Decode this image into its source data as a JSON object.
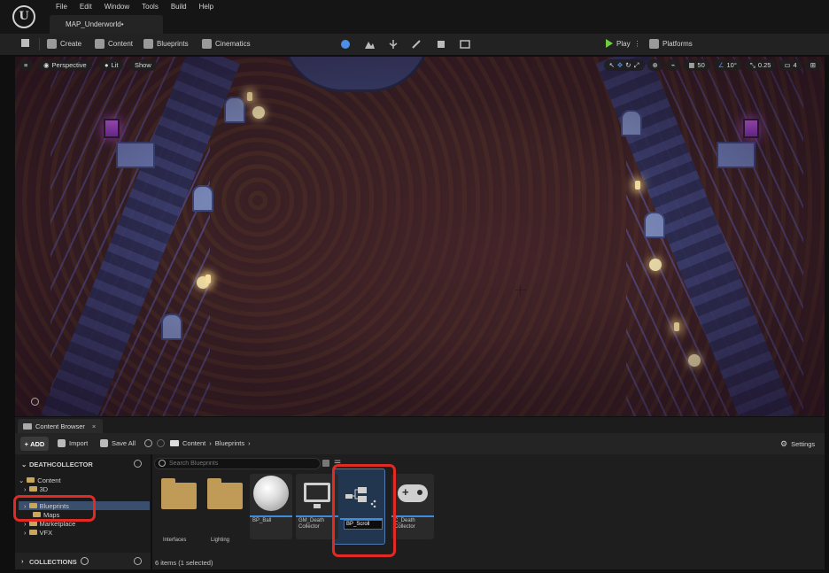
{
  "menu": [
    "File",
    "Edit",
    "Window",
    "Tools",
    "Build",
    "Help"
  ],
  "level_tab": "MAP_Underworld•",
  "toolbar": {
    "create": "Create",
    "content": "Content",
    "blueprints": "Blueprints",
    "cinematics": "Cinematics",
    "play": "Play",
    "platforms": "Platforms"
  },
  "viewport": {
    "perspective": "Perspective",
    "lit": "Lit",
    "show": "Show",
    "grid_size": "50",
    "rotation_snap": "10°",
    "scale_snap": "0.25",
    "camera_speed": "4"
  },
  "content_browser": {
    "tab_title": "Content Browser",
    "add_label": "ADD",
    "import_label": "Import",
    "save_all_label": "Save All",
    "breadcrumb": [
      "Content",
      "Blueprints"
    ],
    "settings_label": "Settings",
    "project_name": "DEATHCOLLECTOR",
    "tree": [
      {
        "label": "Content",
        "indent": 0,
        "expanded": true,
        "selected": false
      },
      {
        "label": "3D",
        "indent": 1,
        "expanded": false,
        "selected": false
      },
      {
        "label": "Blueprints",
        "indent": 1,
        "expanded": false,
        "selected": true
      },
      {
        "label": "Maps",
        "indent": 1,
        "expanded": false,
        "selected": false
      },
      {
        "label": "Marketplace",
        "indent": 1,
        "expanded": false,
        "selected": false
      },
      {
        "label": "VFX",
        "indent": 1,
        "expanded": false,
        "selected": false
      }
    ],
    "collections_label": "COLLECTIONS",
    "search_placeholder": "Search Blueprints",
    "assets": [
      {
        "name": "Interfaces",
        "kind": "folder"
      },
      {
        "name": "Lighting",
        "kind": "folder"
      },
      {
        "name": "BP_Ball",
        "kind": "sphere",
        "strip_color": "#3c8dde"
      },
      {
        "name": "GM_Death Collector",
        "kind": "gamemode",
        "strip_color": "#3c8dde"
      },
      {
        "name": "BP_Scroll",
        "kind": "blueprint",
        "strip_color": "#3c8dde",
        "renaming": true
      },
      {
        "name": "C_Death Collector",
        "kind": "controller",
        "strip_color": "#3c8dde"
      }
    ],
    "status": "6 items (1 selected)"
  },
  "colors": {
    "highlight": "#e02a23",
    "selection": "#3a4e6e",
    "play_green": "#6fcf3b",
    "folder": "#c09a57"
  }
}
